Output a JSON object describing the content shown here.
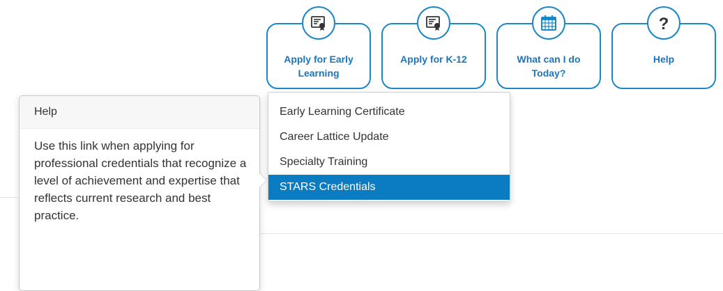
{
  "actions": [
    {
      "label": "Apply for Early\nLearning",
      "icon": "certificate-icon"
    },
    {
      "label": "Apply for K-12",
      "icon": "certificate-icon"
    },
    {
      "label": "What can I do\nToday?",
      "icon": "calendar-icon"
    },
    {
      "label": "Help",
      "icon": "question-icon"
    }
  ],
  "dropdown": {
    "items": [
      {
        "label": "Early Learning Certificate"
      },
      {
        "label": "Career Lattice Update"
      },
      {
        "label": "Specialty Training"
      },
      {
        "label": "STARS Credentials",
        "active": true
      }
    ]
  },
  "popover": {
    "title": "Help",
    "body": "Use this link when applying for professional credentials that recognize a level of achievement and expertise that reflects current research and best practice."
  },
  "colors": {
    "accent": "#1b87c9",
    "accent_text": "#1b75bb",
    "active_bg": "#0b7cc1"
  }
}
